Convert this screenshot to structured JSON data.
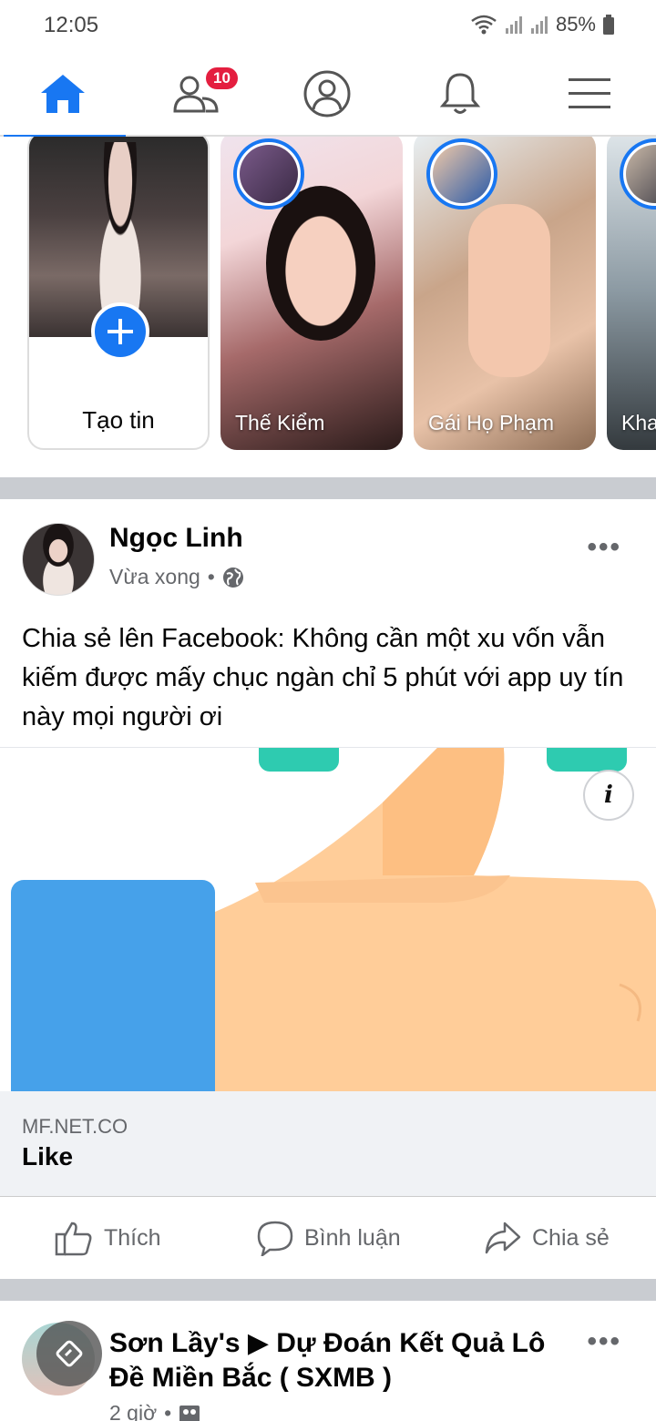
{
  "status_bar": {
    "time": "12:05",
    "battery": "85%"
  },
  "nav": {
    "items": [
      {
        "name": "home",
        "icon": "home-icon",
        "active": true
      },
      {
        "name": "friends",
        "icon": "friends-icon",
        "badge": "10"
      },
      {
        "name": "profile",
        "icon": "profile-icon"
      },
      {
        "name": "notifications",
        "icon": "bell-icon"
      },
      {
        "name": "menu",
        "icon": "hamburger-menu-icon"
      }
    ]
  },
  "stories": {
    "create_label": "Tạo tin",
    "items": [
      {
        "name": "Thế Kiểm"
      },
      {
        "name": "Gái Họ Phạm"
      },
      {
        "name": "Kha"
      }
    ]
  },
  "post": {
    "author": "Ngọc Linh",
    "time": "Vừa xong",
    "privacy_icon": "globe-icon",
    "text": "Chia sẻ lên Facebook: Không cần một xu vốn vẫn kiếm được mấy chục ngàn chỉ 5 phút với app uy tín này mọi người ơi",
    "link": {
      "domain": "MF.NET.CO",
      "title": "Like",
      "info_label": "i"
    },
    "actions": {
      "like": "Thích",
      "comment": "Bình luận",
      "share": "Chia sẻ"
    }
  },
  "post2": {
    "author": "Sơn Lầy's ▶ Dự Đoán Kết Quả Lô Đề Miền Bắc ( SXMB )",
    "time": "2 giờ"
  },
  "colors": {
    "accent": "#1877f2",
    "badge": "#e41e3f",
    "thumb_blue": "#46a1ea",
    "thumb_skin": "#ffcd99",
    "teal": "#2ecbb0"
  }
}
